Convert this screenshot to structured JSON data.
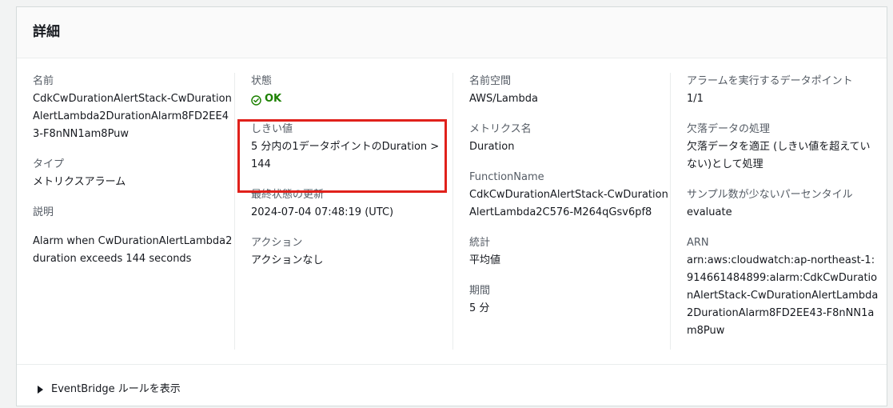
{
  "panel": {
    "title": "詳細"
  },
  "col1": {
    "name_label": "名前",
    "name_value": "CdkCwDurationAlertStack-CwDurationAlertLambda2DurationAlarm8FD2EE43-F8nNN1am8Puw",
    "type_label": "タイプ",
    "type_value": "メトリクスアラーム",
    "description_label": "説明",
    "description_value": "Alarm when CwDurationAlertLambda2 duration exceeds 144 seconds"
  },
  "col2": {
    "state_label": "状態",
    "state_value": "OK",
    "threshold_label": "しきい値",
    "threshold_value": "5 分内の1データポイントのDuration > 144",
    "last_update_label": "最終状態の更新",
    "last_update_value": "2024-07-04 07:48:19 (UTC)",
    "action_label": "アクション",
    "action_value": "アクションなし"
  },
  "col3": {
    "namespace_label": "名前空間",
    "namespace_value": "AWS/Lambda",
    "metric_label": "メトリクス名",
    "metric_value": "Duration",
    "function_label": "FunctionName",
    "function_value": "CdkCwDurationAlertStack-CwDurationAlertLambda2C576-M264qGsv6pf8",
    "stat_label": "統計",
    "stat_value": "平均値",
    "period_label": "期間",
    "period_value": "5 分"
  },
  "col4": {
    "datapoints_label": "アラームを実行するデータポイント",
    "datapoints_value": "1/1",
    "missing_label": "欠落データの処理",
    "missing_value": "欠落データを適正 (しきい値を超えていない)として処理",
    "percentile_label": "サンプル数が少ないパーセンタイル",
    "percentile_value": "evaluate",
    "arn_label": "ARN",
    "arn_value": "arn:aws:cloudwatch:ap-northeast-1:914661484899:alarm:CdkCwDurationAlertStack-CwDurationAlertLambda2DurationAlarm8FD2EE43-F8nNN1am8Puw"
  },
  "footer": {
    "eventbridge_label": "EventBridge ルールを表示"
  },
  "colors": {
    "ok_green": "#1d8102",
    "highlight_red": "#e0211b"
  },
  "icons": {
    "status_ok": "check-circle-icon",
    "expander": "caret-right-icon"
  }
}
